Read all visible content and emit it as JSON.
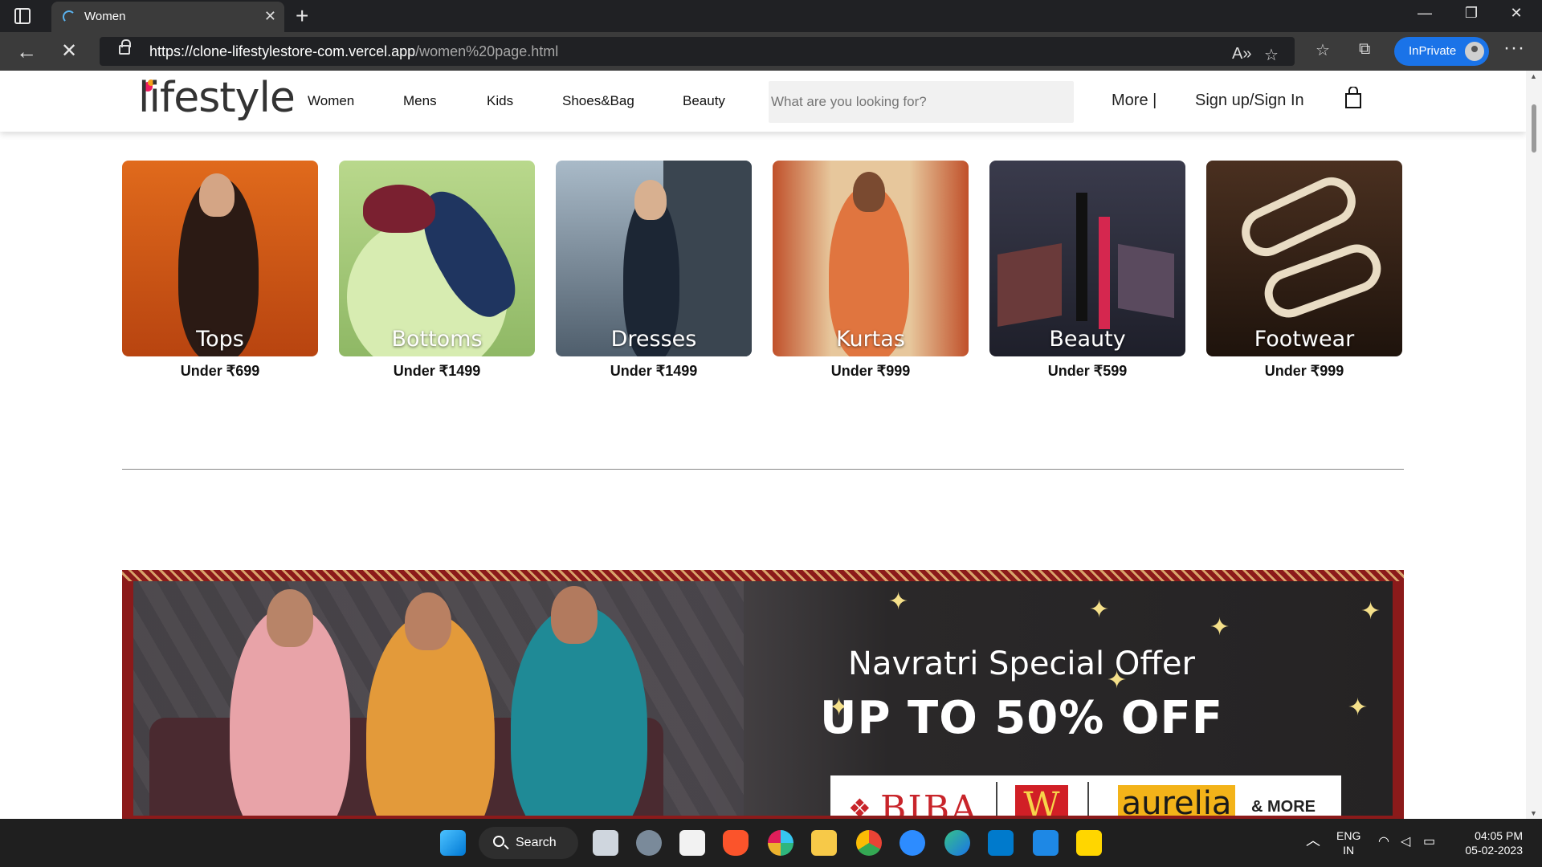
{
  "browser": {
    "tab_title": "Women",
    "url_host": "https://clone-lifestylestore-com.vercel.app",
    "url_path": "/women%20page.html",
    "inprivate_label": "InPrivate"
  },
  "header": {
    "logo_text": "lifestyle",
    "menu": [
      "Women",
      "Mens",
      "Kids",
      "Shoes&Bag",
      "Beauty"
    ],
    "search_placeholder": "What are you looking for?",
    "more_label": "More |",
    "signin_label": "Sign up/Sign In"
  },
  "categories": [
    {
      "label": "Tops",
      "price": "Under ₹699",
      "bg": "#d9621a"
    },
    {
      "label": "Bottoms",
      "price": "Under ₹1499",
      "bg": "#a9cc7a"
    },
    {
      "label": "Dresses",
      "price": "Under ₹1499",
      "bg": "#6d7c8a"
    },
    {
      "label": "Kurtas",
      "price": "Under ₹999",
      "bg": "#c8703a"
    },
    {
      "label": "Beauty",
      "price": "Under ₹599",
      "bg": "#2c2d3c"
    },
    {
      "label": "Footwear",
      "price": "Under ₹999",
      "bg": "#3a2618"
    }
  ],
  "banner": {
    "subtitle": "Navratri Special Offer",
    "title": "UP TO 50% OFF",
    "brands": {
      "biba": "BIBA",
      "w": "W",
      "aurelia": "aurelia",
      "more": "& MORE"
    }
  },
  "taskbar": {
    "search_label": "Search",
    "lang_top": "ENG",
    "lang_bottom": "IN",
    "time": "04:05 PM",
    "date": "05-02-2023"
  }
}
